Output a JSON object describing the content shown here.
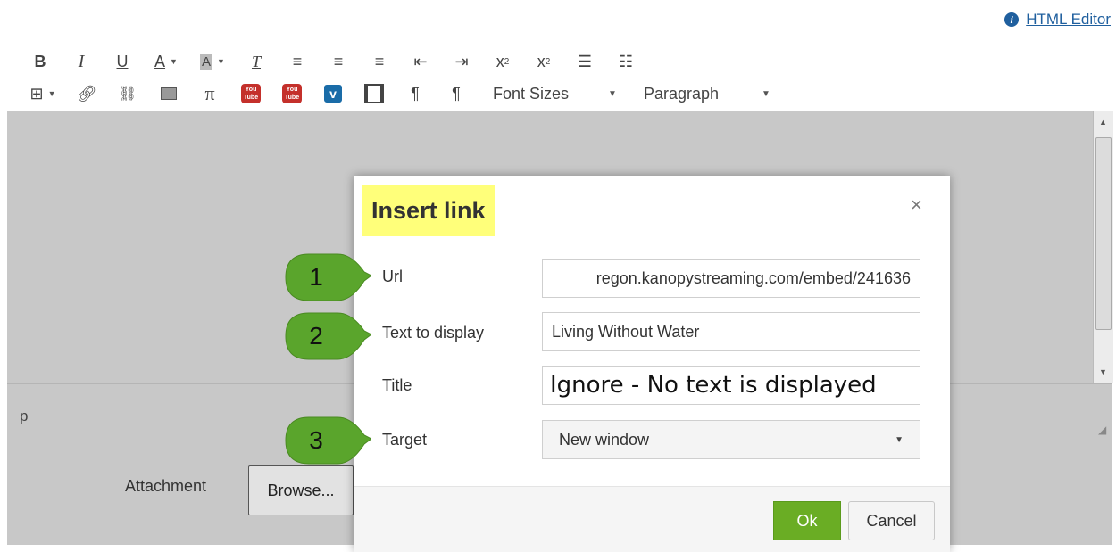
{
  "header": {
    "html_editor_link": "HTML Editor",
    "info_icon": "i"
  },
  "toolbar": {
    "row1": [
      "bold",
      "italic",
      "underline",
      "font-color",
      "background-color",
      "clear-formatting",
      "align-left",
      "align-center",
      "align-right",
      "outdent",
      "indent",
      "superscript",
      "subscript",
      "bullet-list",
      "numbered-list"
    ],
    "row2": [
      "table",
      "link",
      "unlink",
      "image",
      "equation",
      "youtube",
      "youtube",
      "vimeo",
      "media",
      "ltr",
      "rtl"
    ],
    "font_sizes_label": "Font Sizes",
    "paragraph_label": "Paragraph",
    "youtube_text": "You Tube",
    "vimeo_text": "v"
  },
  "editor": {
    "path_label": "p"
  },
  "attachment": {
    "label": "Attachment",
    "browse_label": "Browse..."
  },
  "dialog": {
    "title": "Insert link",
    "close_glyph": "×",
    "fields": {
      "url_label": "Url",
      "url_value": "regon.kanopystreaming.com/embed/241636",
      "text_label": "Text to display",
      "text_value": "Living Without Water",
      "title_label": "Title",
      "title_value": "Ignore - No text is displayed",
      "target_label": "Target",
      "target_value": "New window"
    },
    "ok_label": "Ok",
    "cancel_label": "Cancel"
  },
  "callouts": [
    "1",
    "2",
    "3"
  ],
  "colors": {
    "callout_green": "#5aa52c",
    "highlight": "#ffff7a",
    "ok_green": "#6aad24",
    "link_blue": "#1f5f9e"
  }
}
